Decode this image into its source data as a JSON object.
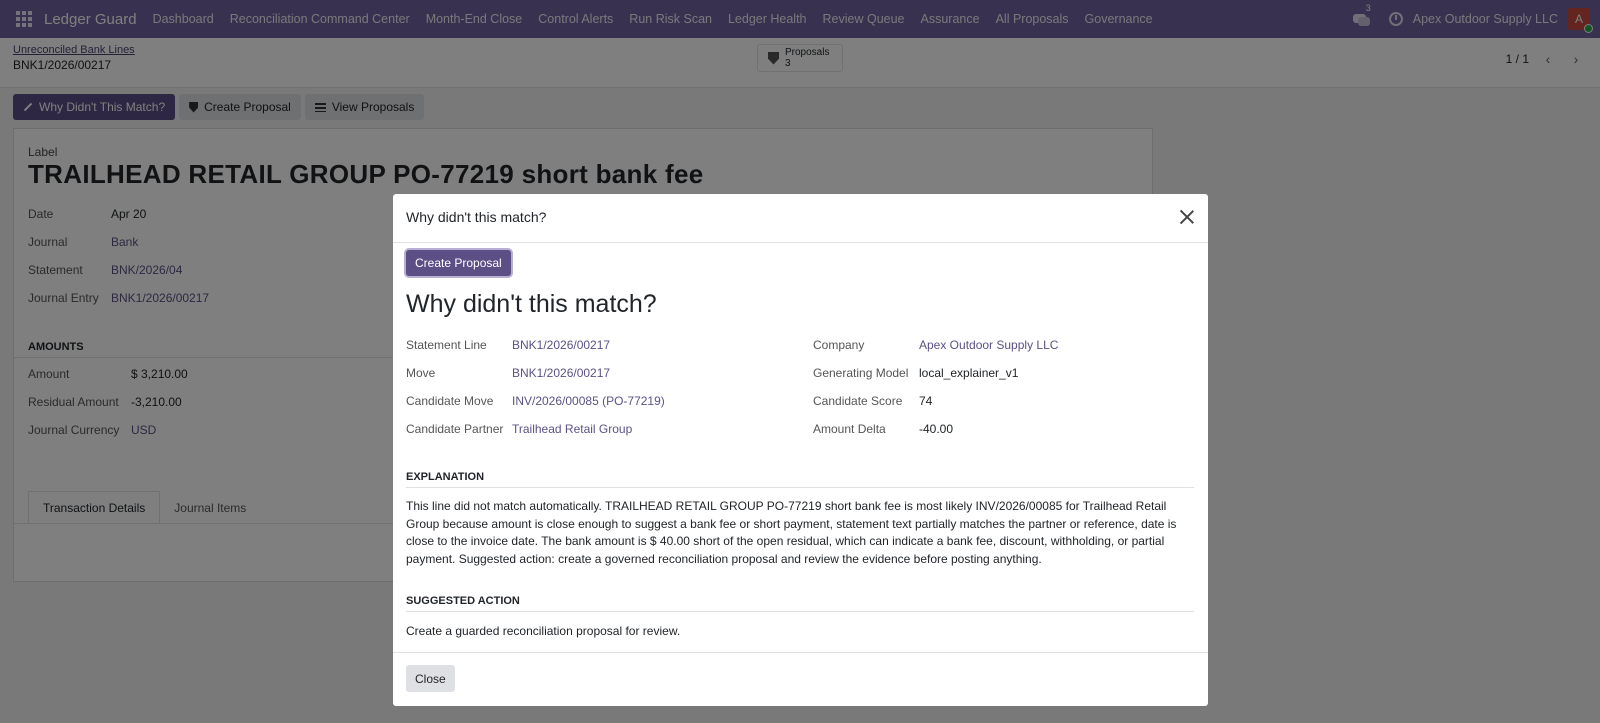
{
  "navbar": {
    "brand": "Ledger Guard",
    "menu": [
      "Dashboard",
      "Reconciliation Command Center",
      "Month-End Close",
      "Control Alerts",
      "Run Risk Scan",
      "Ledger Health",
      "Review Queue",
      "Assurance",
      "All Proposals",
      "Governance"
    ],
    "message_count": "3",
    "company": "Apex Outdoor Supply LLC",
    "avatar_initial": "A"
  },
  "breadcrumb": {
    "parent": "Unreconciled Bank Lines",
    "current": "BNK1/2026/00217"
  },
  "smart_button": {
    "label": "Proposals",
    "count": "3"
  },
  "pager": {
    "value": "1 / 1"
  },
  "actions": {
    "why_label": "Why Didn't This Match?",
    "create_label": "Create Proposal",
    "view_label": "View Proposals"
  },
  "record": {
    "label_caption": "Label",
    "title": "TRAILHEAD RETAIL GROUP PO-77219 short bank fee",
    "fields": [
      {
        "key": "Date",
        "value": "Apr 20"
      },
      {
        "key": "Journal",
        "value": "Bank"
      },
      {
        "key": "Statement",
        "value": "BNK/2026/04"
      },
      {
        "key": "Journal Entry",
        "value": "BNK1/2026/00217"
      }
    ],
    "amounts_title": "AMOUNTS",
    "amounts": [
      {
        "key": "Amount",
        "value": "$ 3,210.00"
      },
      {
        "key": "Residual Amount",
        "value": "-3,210.00"
      },
      {
        "key": "Journal Currency",
        "value": "USD"
      }
    ],
    "tabs": [
      "Transaction Details",
      "Journal Items"
    ]
  },
  "modal": {
    "title": "Why didn't this match?",
    "create_label": "Create Proposal",
    "heading": "Why didn't this match?",
    "left_fields": [
      {
        "key": "Statement Line",
        "value": "BNK1/2026/00217"
      },
      {
        "key": "Move",
        "value": "BNK1/2026/00217"
      },
      {
        "key": "Candidate Move",
        "value": "INV/2026/00085 (PO-77219)"
      },
      {
        "key": "Candidate Partner",
        "value": "Trailhead Retail Group"
      }
    ],
    "right_fields": [
      {
        "key": "Company",
        "value": "Apex Outdoor Supply LLC"
      },
      {
        "key": "Generating Model",
        "value": "local_explainer_v1"
      },
      {
        "key": "Candidate Score",
        "value": "74"
      },
      {
        "key": "Amount Delta",
        "value": "-40.00"
      }
    ],
    "explanation_title": "EXPLANATION",
    "explanation": "This line did not match automatically. TRAILHEAD RETAIL GROUP PO-77219 short bank fee is most likely INV/2026/00085 for Trailhead Retail Group because amount is close enough to suggest a bank fee or short payment, statement text partially matches the partner or reference, date is close to the invoice date. The bank amount is $ 40.00 short of the open residual, which can indicate a bank fee, discount, withholding, or partial payment. Suggested action: create a governed reconciliation proposal and review the evidence before posting anything.",
    "suggested_title": "SUGGESTED ACTION",
    "suggested": "Create a guarded reconciliation proposal for review.",
    "close_label": "Close"
  },
  "colors": {
    "navbar": "#71639e",
    "primary": "#5b4f86",
    "link": "#5c5185"
  }
}
